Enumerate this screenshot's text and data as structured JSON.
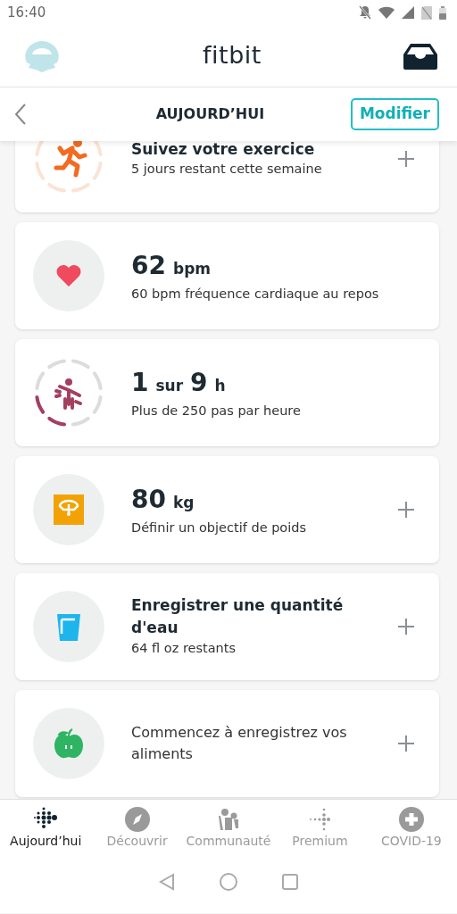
{
  "status_bar": {
    "time": "16:40"
  },
  "header": {
    "logo": "fitbit"
  },
  "subheader": {
    "title": "AUJOURD’HUI",
    "edit_button": "Modifier"
  },
  "tiles": [
    {
      "kind": "exercise",
      "title": "Suivez votre exercice",
      "subtitle": "5 jours restant cette semaine",
      "plus": true
    },
    {
      "kind": "heart",
      "value": "62",
      "unit": "bpm",
      "subtitle": "60 bpm fréquence cardiaque au repos",
      "plus": false
    },
    {
      "kind": "hourly",
      "value": "1",
      "mid": "sur",
      "value2": "9",
      "unit": "h",
      "subtitle": "Plus de 250 pas par heure",
      "plus": false
    },
    {
      "kind": "weight",
      "value": "80",
      "unit": "kg",
      "subtitle": "Définir un objectif de poids",
      "plus": true
    },
    {
      "kind": "water",
      "title": "Enregistrer une quantité d'eau",
      "subtitle": "64 fl oz restants",
      "plus": true
    },
    {
      "kind": "food",
      "subtitle": "Commencez à enregistrez vos aliments",
      "plus": true
    }
  ],
  "bottom_nav": [
    {
      "kind": "today",
      "label": "Aujourd’hui",
      "selected": true
    },
    {
      "kind": "discover",
      "label": "Découvrir",
      "selected": false
    },
    {
      "kind": "community",
      "label": "Communauté",
      "selected": false
    },
    {
      "kind": "premium",
      "label": "Premium",
      "selected": false
    },
    {
      "kind": "covid",
      "label": "COVID-19",
      "selected": false
    }
  ]
}
